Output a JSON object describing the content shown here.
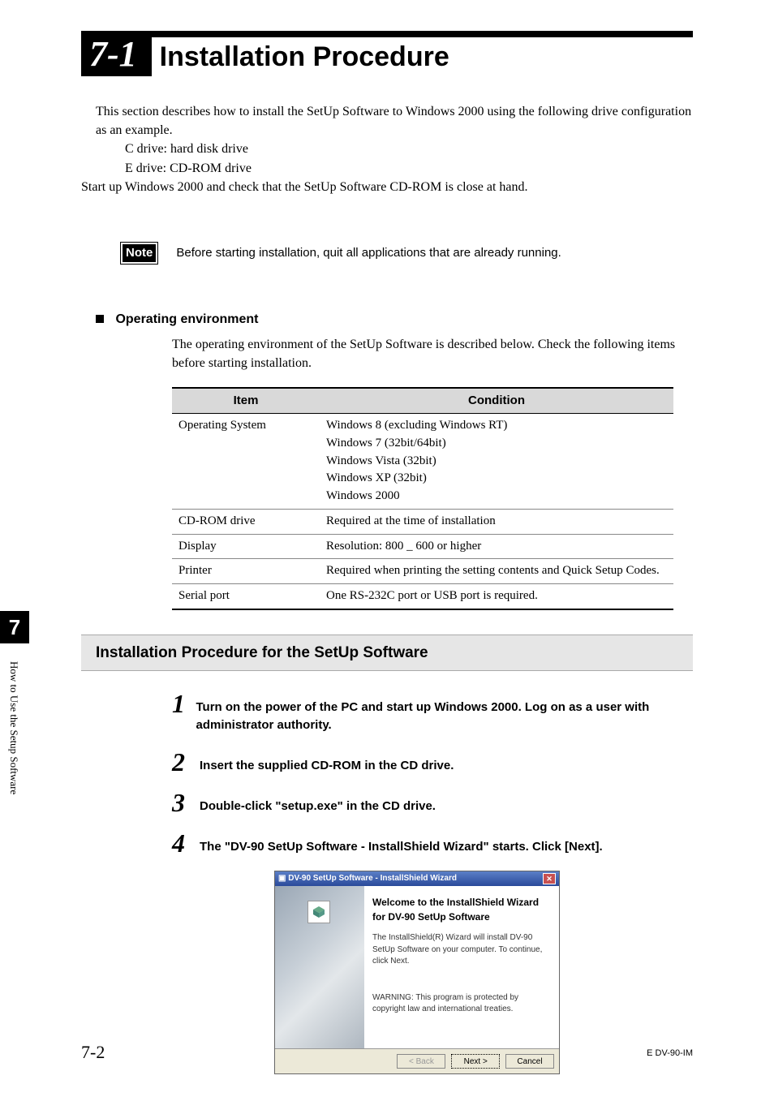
{
  "header": {
    "section_number": "7-1",
    "title": "Installation Procedure"
  },
  "intro": {
    "line1": "This section describes how to install the SetUp Software to Windows 2000 using the following drive configuration as an example.",
    "cdrive": "C drive: hard disk drive",
    "edrive": "E drive: CD-ROM drive",
    "line2": "Start up Windows 2000 and check that the SetUp Software CD-ROM is close at hand."
  },
  "note": {
    "badge": "Note",
    "text": "Before starting installation, quit all applications that are already running."
  },
  "operating_env": {
    "heading": "Operating environment",
    "description": "The operating environment of the SetUp Software is described below. Check the following items before starting installation.",
    "headers": {
      "item": "Item",
      "condition": "Condition"
    },
    "rows": [
      {
        "item": "Operating System",
        "condition": "Windows 8 (excluding Windows RT)\nWindows 7 (32bit/64bit)\nWindows Vista (32bit)\nWindows XP (32bit)\nWindows 2000"
      },
      {
        "item": "CD-ROM drive",
        "condition": "Required at the time of installation"
      },
      {
        "item": "Display",
        "condition": "Resolution: 800 _ 600 or higher"
      },
      {
        "item": "Printer",
        "condition": "Required when printing the setting contents and Quick Setup Codes."
      },
      {
        "item": "Serial port",
        "condition": "One RS-232C port or USB port is required."
      }
    ]
  },
  "procedure": {
    "heading": "Installation Procedure for the SetUp Software",
    "steps": [
      {
        "n": "1",
        "text": "Turn on the power of the PC and start up Windows 2000. Log on as a user with administrator authority."
      },
      {
        "n": "2",
        "text": "Insert the supplied CD-ROM in the CD drive."
      },
      {
        "n": "3",
        "text": "Double-click \"setup.exe\" in the CD drive."
      },
      {
        "n": "4",
        "text": "The \"DV-90 SetUp Software - InstallShield Wizard\" starts. Click [Next]."
      }
    ]
  },
  "wizard": {
    "title": "DV-90 SetUp Software - InstallShield Wizard",
    "heading": "Welcome to the InstallShield Wizard for DV-90 SetUp Software",
    "body1": "The InstallShield(R) Wizard will install DV-90 SetUp Software on your computer. To continue, click Next.",
    "body2": "WARNING: This program is protected by copyright law and international treaties.",
    "buttons": {
      "back": "< Back",
      "next": "Next >",
      "cancel": "Cancel"
    }
  },
  "side": {
    "chapter": "7",
    "label": "How to Use the Setup Software"
  },
  "footer": {
    "page": "7-2",
    "doc": "E DV-90-IM"
  }
}
